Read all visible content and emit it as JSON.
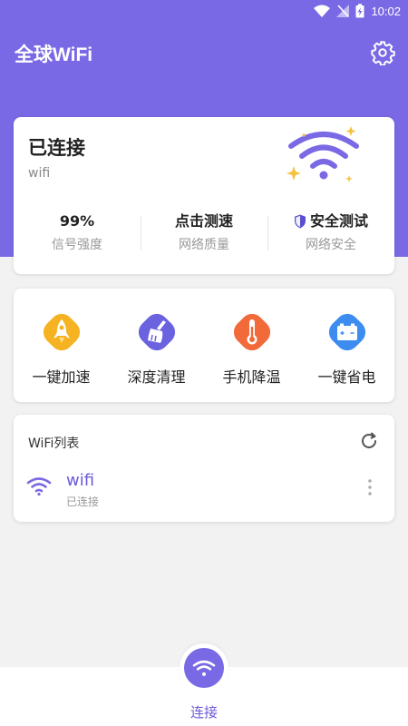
{
  "status_bar": {
    "time": "10:02"
  },
  "app": {
    "title": "全球WiFi"
  },
  "colors": {
    "accent": "#7a69e4",
    "accent_text": "#6a5ad6",
    "background": "#f2f2f2"
  },
  "status_card": {
    "title": "已连接",
    "ssid": "wifi",
    "stats": [
      {
        "value": "99%",
        "label": "信号强度"
      },
      {
        "value": "点击测速",
        "label": "网络质量"
      },
      {
        "value": "安全测试",
        "label": "网络安全",
        "icon": "shield-icon"
      }
    ]
  },
  "tools": [
    {
      "label": "一键加速",
      "icon": "rocket-icon",
      "color": "#f5b321"
    },
    {
      "label": "深度清理",
      "icon": "broom-icon",
      "color": "#6b62e0"
    },
    {
      "label": "手机降温",
      "icon": "thermometer-icon",
      "color": "#f26a3a"
    },
    {
      "label": "一键省电",
      "icon": "battery-icon",
      "color": "#3d8cf0"
    }
  ],
  "wifi_list": {
    "title": "WiFi列表",
    "items": [
      {
        "name": "wifi",
        "status": "已连接"
      }
    ]
  },
  "bottom_nav": {
    "label": "连接"
  }
}
